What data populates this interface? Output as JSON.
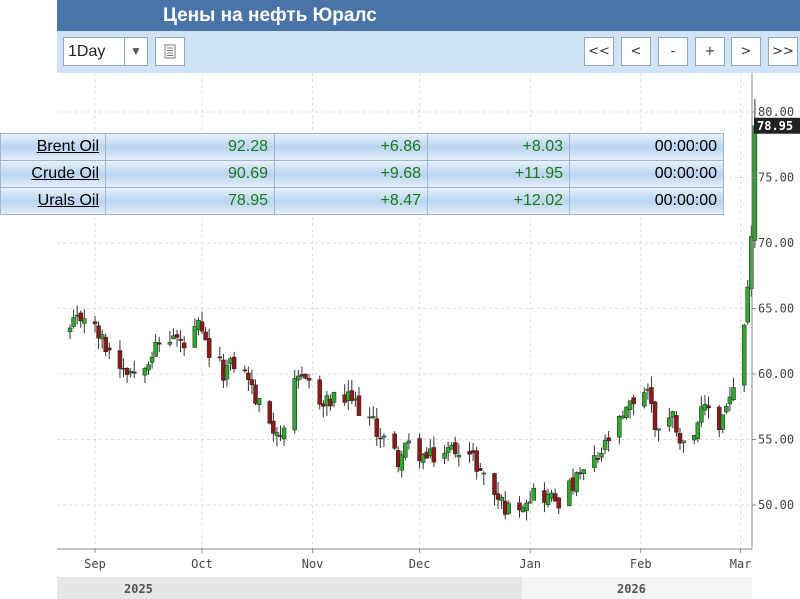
{
  "window": {
    "title": "Цены на нефть Юралс"
  },
  "toolbar": {
    "interval": "1Day",
    "nav": [
      "<<",
      "<",
      "-",
      "+",
      ">",
      ">>"
    ]
  },
  "quotes": [
    {
      "name": "Brent Oil",
      "price": "92.28",
      "change": "+6.86",
      "change_pct": "+8.03",
      "time": "00:00:00"
    },
    {
      "name": "Crude Oil",
      "price": "90.69",
      "change": "+9.68",
      "change_pct": "+11.95",
      "time": "00:00:00"
    },
    {
      "name": "Urals Oil",
      "price": "78.95",
      "change": "+8.47",
      "change_pct": "+12.02",
      "time": "00:00:00"
    }
  ],
  "colors": {
    "up": "#2ea82e",
    "down": "#8b1a1a",
    "title_bar": "#4a74a8",
    "toolbar": "#cfe2f6",
    "last_price_tag": "#222222"
  },
  "chart_data": {
    "type": "candlestick",
    "series_name": "Urals Oil",
    "ylim": [
      47,
      82
    ],
    "y_ticks": [
      "80.00",
      "75.00",
      "70.00",
      "65.00",
      "60.00",
      "55.00",
      "50.00"
    ],
    "x_ticks": [
      "Sep",
      "Oct",
      "Nov",
      "Dec",
      "Jan",
      "Feb",
      "Mar"
    ],
    "years": [
      "2025",
      "2026"
    ],
    "last_price": "78.95",
    "grid": true,
    "close_points": [
      [
        "2025-08-25",
        63.3
      ],
      [
        "2025-08-29",
        64.6
      ],
      [
        "2025-09-03",
        62.5
      ],
      [
        "2025-09-08",
        60.8
      ],
      [
        "2025-09-12",
        60.2
      ],
      [
        "2025-09-16",
        61.4
      ],
      [
        "2025-09-19",
        62.2
      ],
      [
        "2025-09-23",
        62.9
      ],
      [
        "2025-09-26",
        62.0
      ],
      [
        "2025-09-30",
        63.5
      ],
      [
        "2025-10-03",
        61.5
      ],
      [
        "2025-10-07",
        60.2
      ],
      [
        "2025-10-10",
        60.8
      ],
      [
        "2025-10-14",
        59.8
      ],
      [
        "2025-10-16",
        58.0
      ],
      [
        "2025-10-21",
        56.0
      ],
      [
        "2025-10-24",
        55.2
      ],
      [
        "2025-10-27",
        59.0
      ],
      [
        "2025-10-30",
        60.2
      ],
      [
        "2025-11-03",
        57.5
      ],
      [
        "2025-11-07",
        58.0
      ],
      [
        "2025-11-12",
        58.0
      ],
      [
        "2025-11-17",
        56.5
      ],
      [
        "2025-11-21",
        55.0
      ],
      [
        "2025-11-25",
        53.5
      ],
      [
        "2025-11-28",
        54.5
      ],
      [
        "2025-12-03",
        53.5
      ],
      [
        "2025-12-08",
        54.0
      ],
      [
        "2025-12-12",
        54.5
      ],
      [
        "2025-12-16",
        53.5
      ],
      [
        "2025-12-19",
        52.2
      ],
      [
        "2025-12-23",
        50.5
      ],
      [
        "2025-12-26",
        49.6
      ],
      [
        "2025-12-30",
        50.4
      ],
      [
        "2026-01-02",
        51.0
      ],
      [
        "2026-01-06",
        50.6
      ],
      [
        "2026-01-09",
        50.4
      ],
      [
        "2026-01-13",
        51.5
      ],
      [
        "2026-01-16",
        52.5
      ],
      [
        "2026-01-20",
        53.5
      ],
      [
        "2026-01-23",
        55.0
      ],
      [
        "2026-01-27",
        56.5
      ],
      [
        "2026-01-30",
        58.0
      ],
      [
        "2026-02-03",
        59.0
      ],
      [
        "2026-02-05",
        56.0
      ],
      [
        "2026-02-10",
        56.8
      ],
      [
        "2026-02-13",
        54.5
      ],
      [
        "2026-02-17",
        56.5
      ],
      [
        "2026-02-20",
        57.5
      ],
      [
        "2026-02-23",
        56.0
      ],
      [
        "2026-02-25",
        57.8
      ],
      [
        "2026-02-27",
        58.5
      ],
      [
        "2026-03-02",
        63.5
      ],
      [
        "2026-03-04",
        70.0
      ],
      [
        "2026-03-05",
        78.95
      ]
    ]
  }
}
